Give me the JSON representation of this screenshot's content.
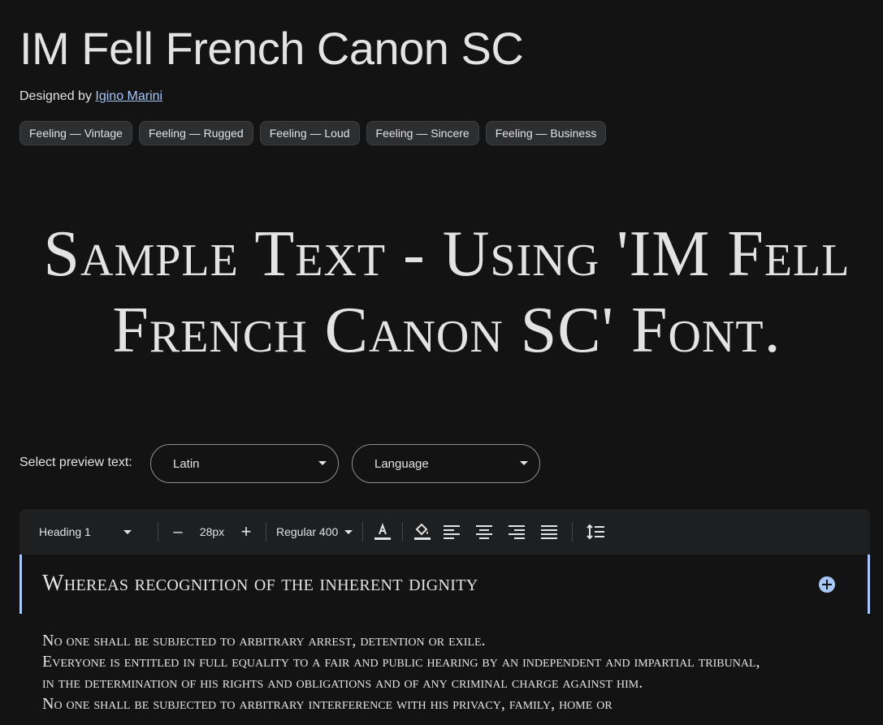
{
  "font": {
    "title": "IM Fell French Canon SC",
    "designed_by_label": "Designed by",
    "designer": "Igino Marini"
  },
  "tags": [
    "Feeling — Vintage",
    "Feeling — Rugged",
    "Feeling — Loud",
    "Feeling — Sincere",
    "Feeling — Business"
  ],
  "hero": {
    "line1": "Sample Text - Using 'IM Fell",
    "line2": "French Canon SC' Font."
  },
  "preview": {
    "label": "Select preview text:",
    "script_value": "Latin",
    "language_placeholder": "Language"
  },
  "toolbar": {
    "style": "Heading 1",
    "decrease_label": "–",
    "size": "28px",
    "increase_label": "+",
    "weight": "Regular 400",
    "icons": [
      "text-color-icon",
      "highlight-icon",
      "align-left-icon",
      "align-center-icon",
      "align-right-icon",
      "align-justify-icon",
      "line-height-icon"
    ]
  },
  "editor": {
    "heading": "Whereas recognition of the inherent dignity",
    "paragraphs": [
      "No one shall be subjected to arbitrary arrest, detention or exile.",
      "Everyone is entitled in full equality to a fair and public hearing by an independent and impartial tribunal, in the determination of his rights and obligations and of any criminal charge against him.",
      "No one shall be subjected to arbitrary interference with his privacy, family, home or"
    ]
  },
  "colors": {
    "background": "#131314",
    "accent": "#a8c7fa",
    "chip": "#2d2e30",
    "toolbar": "#1e1f20"
  }
}
